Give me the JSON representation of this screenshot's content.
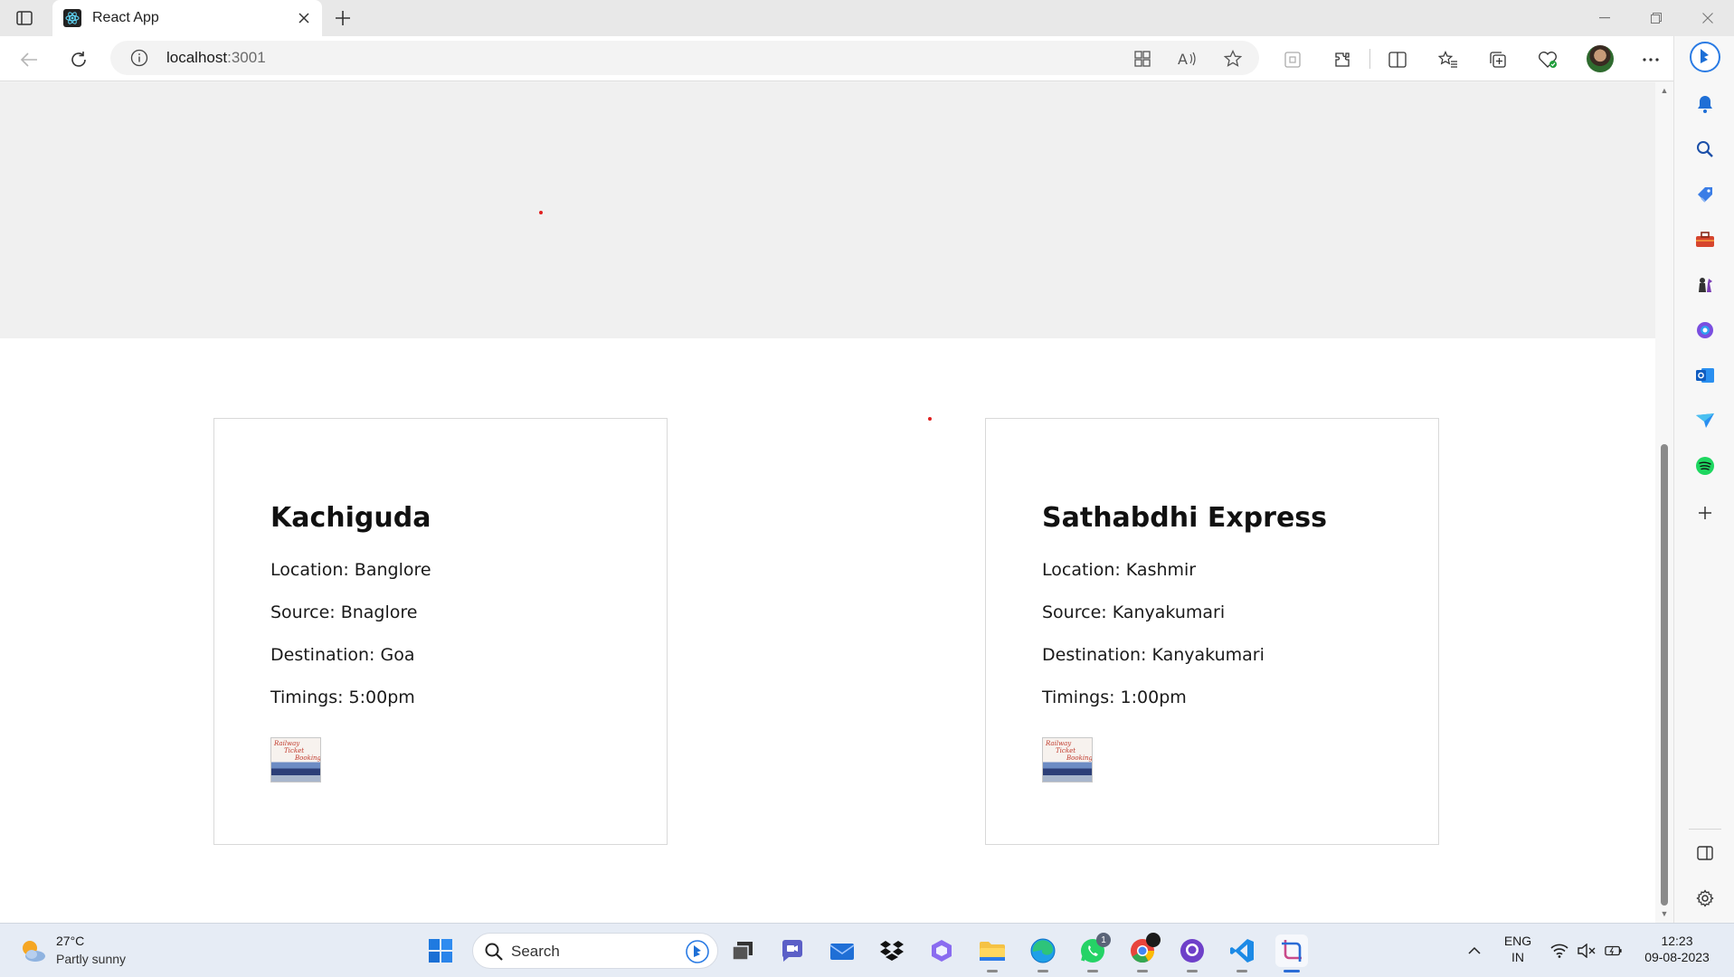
{
  "browser": {
    "tab": {
      "title": "React App"
    },
    "address": {
      "host": "localhost",
      "port": ":3001"
    }
  },
  "page": {
    "cards": [
      {
        "title": "Kachiguda",
        "location": "Location: Banglore",
        "source": "Source: Bnaglore",
        "destination": "Destination: Goa",
        "timings": "Timings: 5:00pm",
        "image_text": [
          "Railway",
          "Ticket",
          "Booking"
        ]
      },
      {
        "title": "Sathabdhi Express",
        "location": "Location: Kashmir",
        "source": "Source: Kanyakumari",
        "destination": "Destination: Kanyakumari",
        "timings": "Timings: 1:00pm",
        "image_text": [
          "Railway",
          "Ticket",
          "Booking"
        ]
      }
    ]
  },
  "taskbar": {
    "weather": {
      "temp": "27°C",
      "condition": "Partly sunny"
    },
    "search_label": "Search",
    "whatsapp_badge": "1",
    "language": {
      "line1": "ENG",
      "line2": "IN"
    },
    "clock": {
      "time": "12:23",
      "date": "09-08-2023"
    }
  },
  "icons": [
    "tab-actions-icon",
    "react-favicon-icon",
    "close-icon",
    "new-tab-icon",
    "minimize-icon",
    "restore-icon",
    "window-close-icon",
    "back-icon",
    "refresh-icon",
    "info-icon",
    "apps-icon",
    "read-aloud-icon",
    "favorite-star-icon",
    "extension-box-icon",
    "extensions-icon",
    "split-screen-icon",
    "favorites-icon",
    "collections-icon",
    "browser-essentials-icon",
    "more-icon",
    "bing-copilot-icon",
    "bell-icon",
    "search-icon",
    "tag-icon",
    "toolbox-icon",
    "chess-icon",
    "office-icon",
    "outlook-icon",
    "send-icon",
    "spotify-icon",
    "add-icon",
    "sidebar-toggle-icon",
    "settings-gear-icon",
    "windows-start-icon",
    "task-view-icon",
    "chat-icon",
    "mail-icon",
    "dropbox-icon",
    "copilot-icon",
    "file-explorer-icon",
    "edge-icon",
    "whatsapp-icon",
    "chrome-icon",
    "github-icon",
    "vscode-icon",
    "snipping-tool-icon",
    "chevron-up-icon",
    "wifi-icon",
    "speaker-muted-icon",
    "battery-icon"
  ],
  "colors": {
    "accent": "#2b6cd6",
    "dot": "#e02020"
  }
}
